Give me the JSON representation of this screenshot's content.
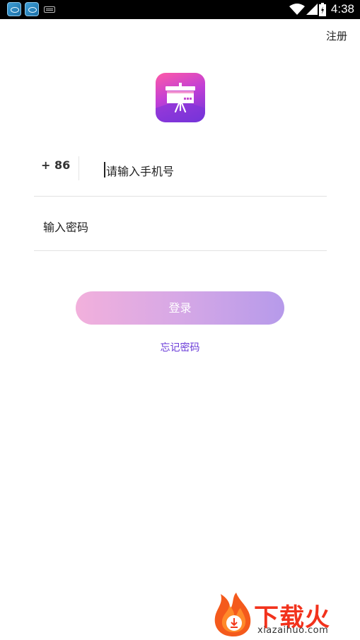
{
  "status_bar": {
    "time": "4:38",
    "icons": [
      "app-icon",
      "app-icon",
      "keyboard-icon",
      "wifi-icon",
      "signal-icon",
      "battery-icon"
    ]
  },
  "header": {
    "register_label": "注册"
  },
  "logo": {
    "icon": "easel-board-icon",
    "colors": [
      "#ff5aa6",
      "#c13fd6",
      "#6b33d8"
    ]
  },
  "login_form": {
    "country_code": "+ 86",
    "phone_placeholder": "请输入手机号",
    "password_placeholder": "输入密码",
    "login_button": "登录",
    "forgot_password": "忘记密码"
  },
  "colors": {
    "accent": "#6a3bd8",
    "button_start": "#f2b0dc",
    "button_end": "#b69aea"
  },
  "watermark": {
    "brand": "下载火",
    "url": "xiazaihuo.com"
  }
}
